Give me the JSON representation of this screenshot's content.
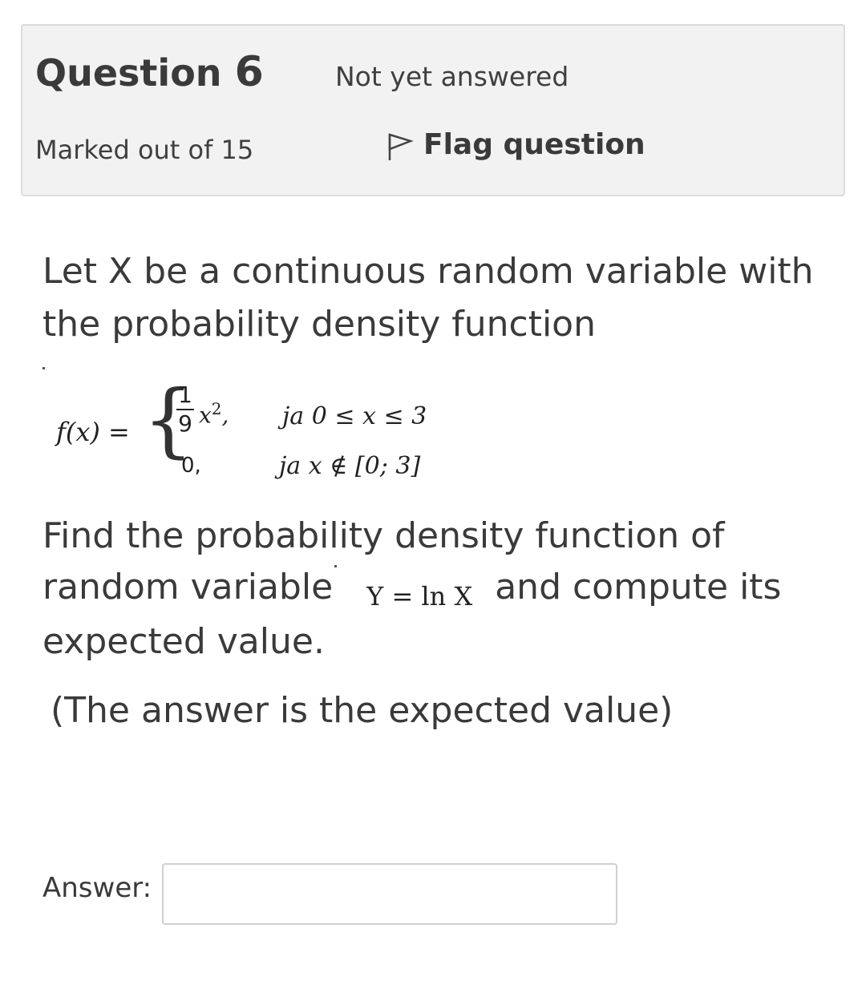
{
  "info": {
    "question_label": "Question",
    "question_number": "6",
    "state": "Not yet answered",
    "grade": "Marked out of 15",
    "flag_label": "Flag question"
  },
  "question": {
    "line1": "Let X be a continuous random variable with",
    "line2": "the probability density function",
    "formula": {
      "lhs": "f(x)",
      "equals": "=",
      "frac_num": "1",
      "frac_den": "9",
      "x_term": "x",
      "exponent": "2",
      "comma": ",",
      "zero_case": "0,",
      "cond1": "ja  0 ≤ x ≤ 3",
      "cond2": "ja  x ∉ [0; 3]"
    },
    "line3": "Find the probability density function of",
    "line4_pre": "random variable",
    "line4_math": "Y = ln X",
    "line4_post": "and compute its",
    "line5": "expected value.",
    "note": "(The answer is the expected value)"
  },
  "answer": {
    "label": "Answer:",
    "value": ""
  }
}
